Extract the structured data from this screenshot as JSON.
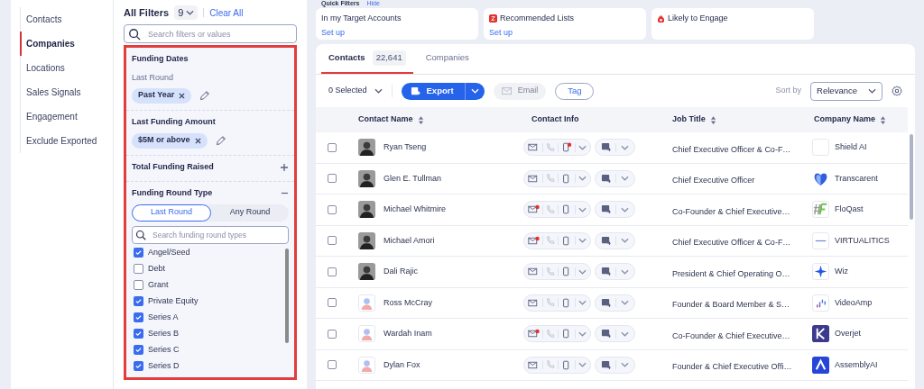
{
  "nav": [
    {
      "label": "Contacts",
      "selected": false
    },
    {
      "label": "Companies",
      "selected": true
    },
    {
      "label": "Locations",
      "selected": false
    },
    {
      "label": "Sales Signals",
      "selected": false
    },
    {
      "label": "Engagement",
      "selected": false
    },
    {
      "label": "Exclude Exported",
      "selected": false
    }
  ],
  "filters": {
    "title": "All Filters",
    "count": "9",
    "clear": "Clear All",
    "search_placeholder": "Search filters or values",
    "sections": [
      {
        "kind": "chips",
        "title": "Funding Dates",
        "sublabel": "Last Round",
        "chips": [
          "Past Year"
        ]
      },
      {
        "kind": "chips",
        "title": "Last Funding Amount",
        "chips": [
          "$5M or above"
        ]
      },
      {
        "kind": "expandable",
        "title": "Total Funding Raised",
        "expanded": false
      },
      {
        "kind": "expandable",
        "title": "Funding Round Type",
        "expanded": true,
        "toggle": [
          {
            "label": "Last Round",
            "selected": true
          },
          {
            "label": "Any Round",
            "selected": false
          }
        ],
        "search_placeholder": "Search funding round types",
        "options": [
          {
            "label": "Angel/Seed",
            "checked": true
          },
          {
            "label": "Debt",
            "checked": false
          },
          {
            "label": "Grant",
            "checked": false
          },
          {
            "label": "Private Equity",
            "checked": true
          },
          {
            "label": "Series A",
            "checked": true
          },
          {
            "label": "Series B",
            "checked": true
          },
          {
            "label": "Series C",
            "checked": true
          },
          {
            "label": "Series D",
            "checked": true
          }
        ]
      }
    ]
  },
  "quick_filters": {
    "title": "Quick Filters",
    "hide": "Hide",
    "cards": [
      {
        "kind": "target",
        "label": "In my Target Accounts",
        "link": "Set up"
      },
      {
        "kind": "lists",
        "label": "Recommended Lists",
        "link": "Set up"
      },
      {
        "kind": "engage",
        "label": "Likely to Engage"
      }
    ]
  },
  "tabs": [
    {
      "label": "Contacts",
      "count": "22,641",
      "selected": true
    },
    {
      "label": "Companies",
      "selected": false
    }
  ],
  "toolbar": {
    "selected": "0 Selected",
    "export": "Export",
    "email": "Email",
    "tag": "Tag",
    "sort_label": "Sort by",
    "sort_value": "Relevance"
  },
  "table": {
    "columns": [
      {
        "label": "Contact Name",
        "sortable": true
      },
      {
        "label": "Contact Info",
        "sortable": false
      },
      {
        "label": "Job Title",
        "sortable": true
      },
      {
        "label": "Company Name",
        "sortable": true
      }
    ],
    "rows": [
      {
        "selected": false,
        "name": "Ryan Tseng",
        "avatar": {
          "kind": "photo"
        },
        "email_alert": false,
        "mobile_alert": true,
        "title": "Chief Executive Officer & Co-F…",
        "company": "Shield AI"
      },
      {
        "selected": false,
        "name": "Glen E. Tullman",
        "avatar": {
          "kind": "photo"
        },
        "email_alert": false,
        "mobile_alert": false,
        "title": "Chief Executive Officer",
        "company": "Transcarent"
      },
      {
        "selected": false,
        "name": "Michael Whitmire",
        "avatar": {
          "kind": "photo"
        },
        "email_alert": true,
        "mobile_alert": false,
        "title": "Co-Founder & Chief Executive…",
        "company": "FloQast"
      },
      {
        "selected": false,
        "name": "Michael Amori",
        "avatar": {
          "kind": "photo"
        },
        "email_alert": true,
        "mobile_alert": false,
        "title": "Chief Executive Officer & Co-F…",
        "company": "VIRTUALITICS"
      },
      {
        "selected": false,
        "name": "Dali Rajic",
        "avatar": {
          "kind": "photo"
        },
        "email_alert": false,
        "mobile_alert": false,
        "title": "President & Chief Operating O…",
        "company": "Wiz"
      },
      {
        "selected": false,
        "name": "Ross McCray",
        "avatar": {
          "kind": "placeholder"
        },
        "email_alert": false,
        "mobile_alert": false,
        "title": "Founder & Board Member & S…",
        "company": "VideoAmp"
      },
      {
        "selected": false,
        "name": "Wardah Inam",
        "avatar": {
          "kind": "placeholder"
        },
        "email_alert": true,
        "mobile_alert": false,
        "title": "Co-Founder & Chief Executive…",
        "company": "Overjet"
      },
      {
        "selected": false,
        "name": "Dylan Fox",
        "avatar": {
          "kind": "placeholder"
        },
        "email_alert": false,
        "mobile_alert": false,
        "title": "Founder & Chief Executive Offi…",
        "company": "AssemblyAI"
      }
    ]
  }
}
